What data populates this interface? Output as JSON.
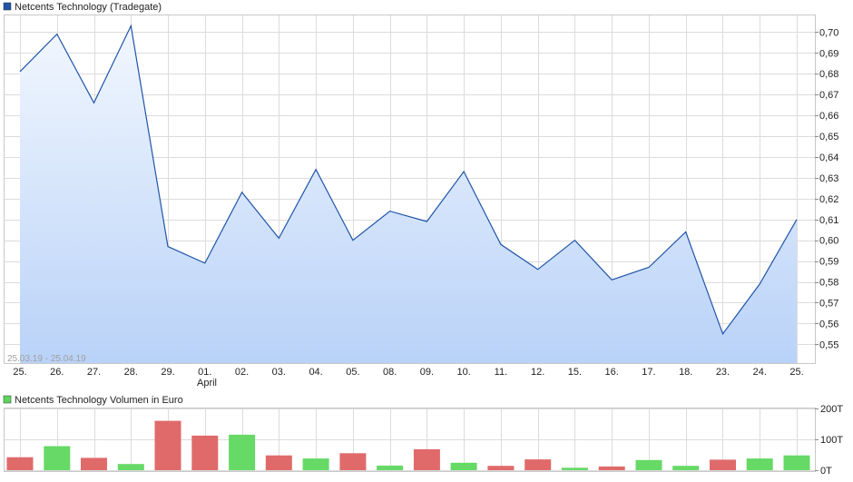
{
  "chart_data": [
    {
      "type": "area",
      "legend": "Netcents Technology (Tradegate)",
      "series_color": "#1f55a8",
      "fill_top": "#f2f7fe",
      "fill_bottom": "#b9d2f8",
      "date_range": "25.03.19 - 25.04.19",
      "x_labels": [
        "25.",
        "26.",
        "27.",
        "28.",
        "29.",
        "01.",
        "02.",
        "03.",
        "04.",
        "05.",
        "08.",
        "09.",
        "10.",
        "11.",
        "12.",
        "15.",
        "16.",
        "17.",
        "18.",
        "23.",
        "24.",
        "25."
      ],
      "month_label": "April",
      "values": [
        0.681,
        0.699,
        0.666,
        0.703,
        0.597,
        0.589,
        0.623,
        0.601,
        0.634,
        0.6,
        0.614,
        0.609,
        0.633,
        0.598,
        0.586,
        0.6,
        0.581,
        0.587,
        0.604,
        0.555,
        0.579,
        0.61
      ],
      "y_ticks": [
        "0,55",
        "0,56",
        "0,57",
        "0,58",
        "0,59",
        "0,60",
        "0,61",
        "0,62",
        "0,63",
        "0,64",
        "0,65",
        "0,66",
        "0,67",
        "0,68",
        "0,69",
        "0,70"
      ],
      "y_tick_values": [
        0.55,
        0.56,
        0.57,
        0.58,
        0.59,
        0.6,
        0.61,
        0.62,
        0.63,
        0.64,
        0.65,
        0.66,
        0.67,
        0.68,
        0.69,
        0.7
      ],
      "ylim": [
        0.541,
        0.708
      ],
      "grid": true
    },
    {
      "type": "bar",
      "legend": "Netcents Technology Volumen in Euro",
      "legend_color": "#5cd65c",
      "up_color": "#66d966",
      "down_color": "#e06a6a",
      "values": [
        42,
        78,
        40,
        20,
        160,
        112,
        115,
        48,
        38,
        55,
        15,
        68,
        24,
        14,
        35,
        8,
        12,
        33,
        14,
        34,
        38,
        48
      ],
      "directions": [
        "down",
        "up",
        "down",
        "up",
        "down",
        "down",
        "up",
        "down",
        "up",
        "down",
        "up",
        "down",
        "up",
        "down",
        "down",
        "up",
        "down",
        "up",
        "up",
        "down",
        "up",
        "up"
      ],
      "y_ticks": [
        "0T",
        "100T",
        "200T"
      ],
      "y_tick_values": [
        0,
        100,
        200
      ],
      "ylim": [
        0,
        200
      ]
    }
  ]
}
